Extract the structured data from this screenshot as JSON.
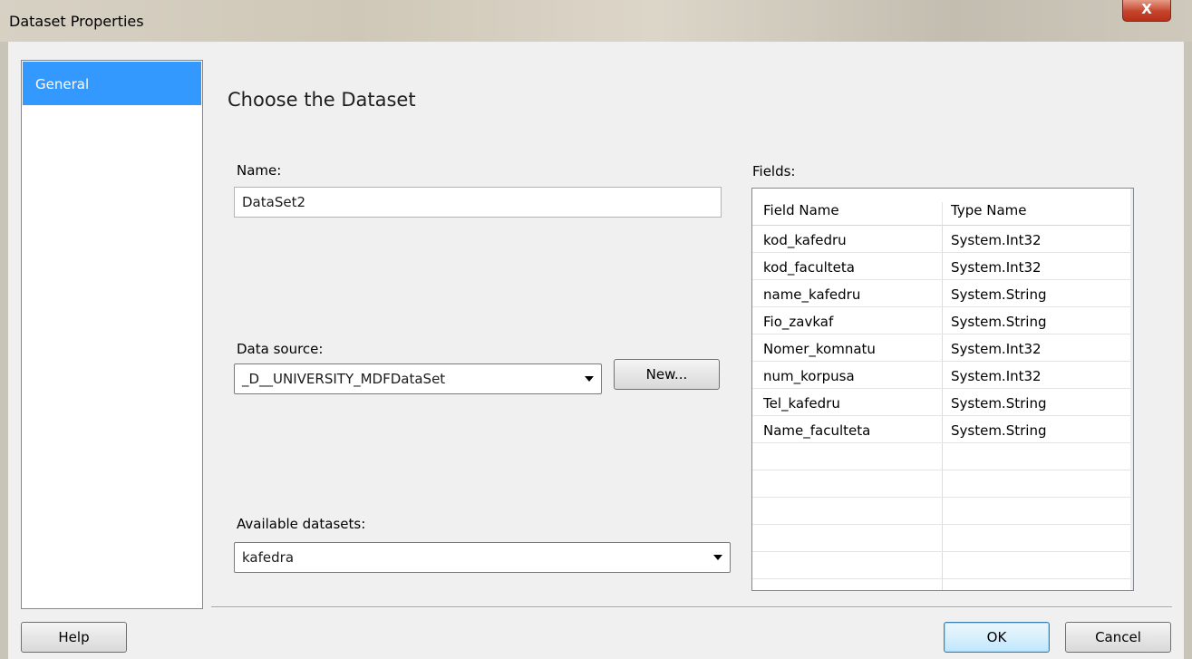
{
  "window": {
    "title": "Dataset Properties",
    "close_label": "X"
  },
  "sidebar": {
    "items": [
      {
        "label": "General",
        "selected": true
      }
    ]
  },
  "main": {
    "heading": "Choose the Dataset",
    "name_label": "Name:",
    "name_value": "DataSet2",
    "data_source_label": "Data source:",
    "data_source_value": "_D__UNIVERSITY_MDFDataSet",
    "new_button": "New...",
    "available_label": "Available datasets:",
    "available_value": "kafedra"
  },
  "fields": {
    "label": "Fields:",
    "columns": [
      "Field Name",
      "Type Name"
    ],
    "rows": [
      [
        "kod_kafedru",
        "System.Int32"
      ],
      [
        "kod_faculteta",
        "System.Int32"
      ],
      [
        "name_kafedru",
        "System.String"
      ],
      [
        "Fio_zavkaf",
        "System.String"
      ],
      [
        "Nomer_komnatu",
        "System.Int32"
      ],
      [
        "num_korpusa",
        "System.Int32"
      ],
      [
        "Tel_kafedru",
        "System.String"
      ],
      [
        "Name_faculteta",
        "System.String"
      ]
    ]
  },
  "footer": {
    "help": "Help",
    "ok": "OK",
    "cancel": "Cancel"
  },
  "colors": {
    "selection": "#3399ff",
    "close_button": "#c5442c"
  }
}
